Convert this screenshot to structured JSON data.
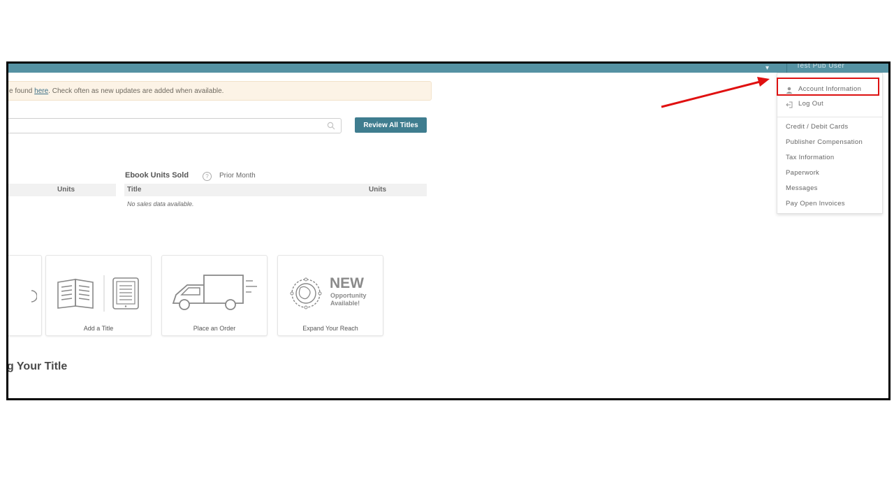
{
  "topbar": {
    "user_name": "Test Pub User"
  },
  "banner": {
    "prefix": "e found ",
    "link": "here",
    "suffix": ". Check often as new updates are added when available."
  },
  "search": {
    "placeholder": ""
  },
  "review_button": "Review All Titles",
  "print_table": {
    "units_header": "Units"
  },
  "ebook": {
    "title": "Ebook Units Sold",
    "help_glyph": "?",
    "period": "Prior Month",
    "col_title": "Title",
    "col_units": "Units",
    "empty": "No sales data available."
  },
  "cards": {
    "add_title": "Add a Title",
    "place_order": "Place an Order",
    "expand_reach": "Expand Your Reach",
    "new_big": "NEW",
    "new_line1": "Opportunity",
    "new_line2": "Available!"
  },
  "section_title": "g Your Title",
  "menu": {
    "items": [
      "Account Information",
      "Log Out",
      "Credit / Debit Cards",
      "Publisher Compensation",
      "Tax Information",
      "Paperwork",
      "Messages",
      "Pay Open Invoices"
    ]
  },
  "colors": {
    "topbar": "#5592a3",
    "button": "#3f7d8f",
    "highlight": "#dd1111",
    "banner": "#fcf3e6"
  }
}
